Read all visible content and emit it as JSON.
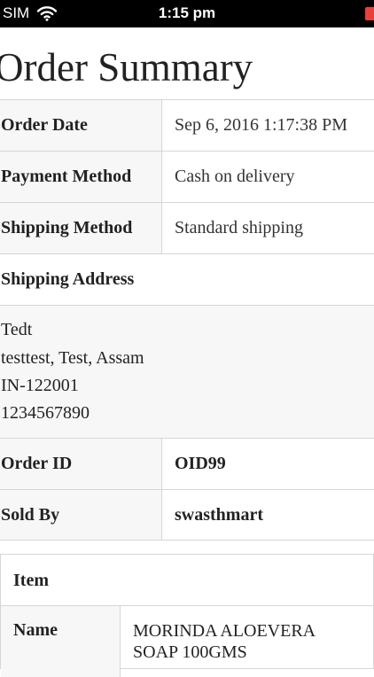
{
  "status_bar": {
    "carrier": "SIM",
    "time": "1:15 pm",
    "icons": [
      "wifi-icon",
      "battery-icon"
    ],
    "battery_color": "#e8413c"
  },
  "page": {
    "title": "Order Summary"
  },
  "summary": {
    "order_date": {
      "label": "Order Date",
      "value": "Sep 6, 2016 1:17:38 PM"
    },
    "payment_method": {
      "label": "Payment Method",
      "value": "Cash on delivery"
    },
    "shipping_method": {
      "label": "Shipping Method",
      "value": "Standard shipping"
    },
    "shipping_address": {
      "label": "Shipping Address",
      "lines": [
        "Tedt",
        "testtest, Test, Assam",
        "IN-122001",
        "1234567890"
      ]
    },
    "order_id": {
      "label": "Order ID",
      "value": "OID99"
    },
    "sold_by": {
      "label": "Sold By",
      "value": "swasthmart"
    }
  },
  "items": {
    "header": "Item",
    "rows": [
      {
        "label": "Name",
        "value": "MORINDA ALOEVERA SOAP 100GMS"
      }
    ]
  },
  "colors": {
    "border": "#d6d6d6",
    "label_background": "#f7f7f7",
    "status_bar_background": "#000000"
  }
}
